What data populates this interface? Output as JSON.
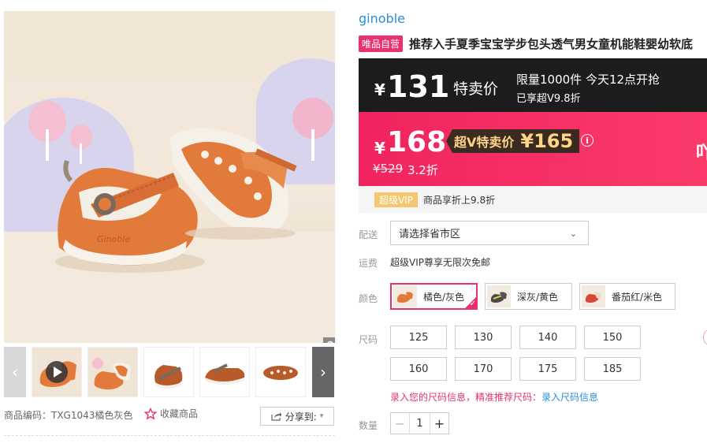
{
  "gallery": {
    "zoom_icon": "magnifier-icon",
    "prev_icon": "chevron-left-icon",
    "next_icon": "chevron-right-icon",
    "play_icon": "play-icon"
  },
  "product": {
    "brand": "ginoble",
    "vip_tag": "唯品自营",
    "title": "推荐入手夏季宝宝学步包头透气男女童机能鞋婴幼软底"
  },
  "flash": {
    "currency": "¥",
    "price": "131",
    "label": "特卖价",
    "limit": "限量1000件 今天12点开抢",
    "enjoy": "已享超V9.8折"
  },
  "price": {
    "currency": "¥",
    "price": "168",
    "svip_label": "超V特卖价",
    "svip_price": "¥165",
    "info_icon": "info-icon",
    "original": "¥529",
    "discount": "3.2折",
    "edge_text": "吖"
  },
  "vip": {
    "chip": "超级VIP",
    "text": "商品享折上9.8折"
  },
  "delivery": {
    "label": "配送",
    "placeholder": "请选择省市区",
    "chevron_icon": "chevron-down-icon"
  },
  "shipping": {
    "label": "运费",
    "text": "超级VIP尊享无限次免邮"
  },
  "colors": {
    "label": "颜色",
    "options": [
      {
        "name": "橘色/灰色",
        "selected": true
      },
      {
        "name": "深灰/黄色",
        "selected": false
      },
      {
        "name": "番茄红/米色",
        "selected": false
      }
    ]
  },
  "sizes": {
    "label": "尺码",
    "options": [
      "125",
      "130",
      "140",
      "150",
      "160",
      "170",
      "175",
      "185"
    ],
    "hint_a": "录入您的尺码信息，精准推荐尺码：",
    "hint_b": "录入尺码信息"
  },
  "quantity": {
    "label": "数量",
    "value": "1",
    "minus": "−",
    "plus": "+"
  },
  "footer": {
    "sku": "商品编码：TXG1043橘色灰色",
    "favorite": "收藏商品",
    "favorite_icon": "star-icon",
    "share": "分享到:",
    "share_icon": "share-icon"
  },
  "colors_theme": {
    "brand_blue": "#2a8fd6",
    "vip_pink": "#e8316e",
    "flash_black": "#1c1c1c",
    "price_pink": "#f0245f",
    "svip_gold": "#ffd58a",
    "vip_chip": "#f3c86f"
  }
}
